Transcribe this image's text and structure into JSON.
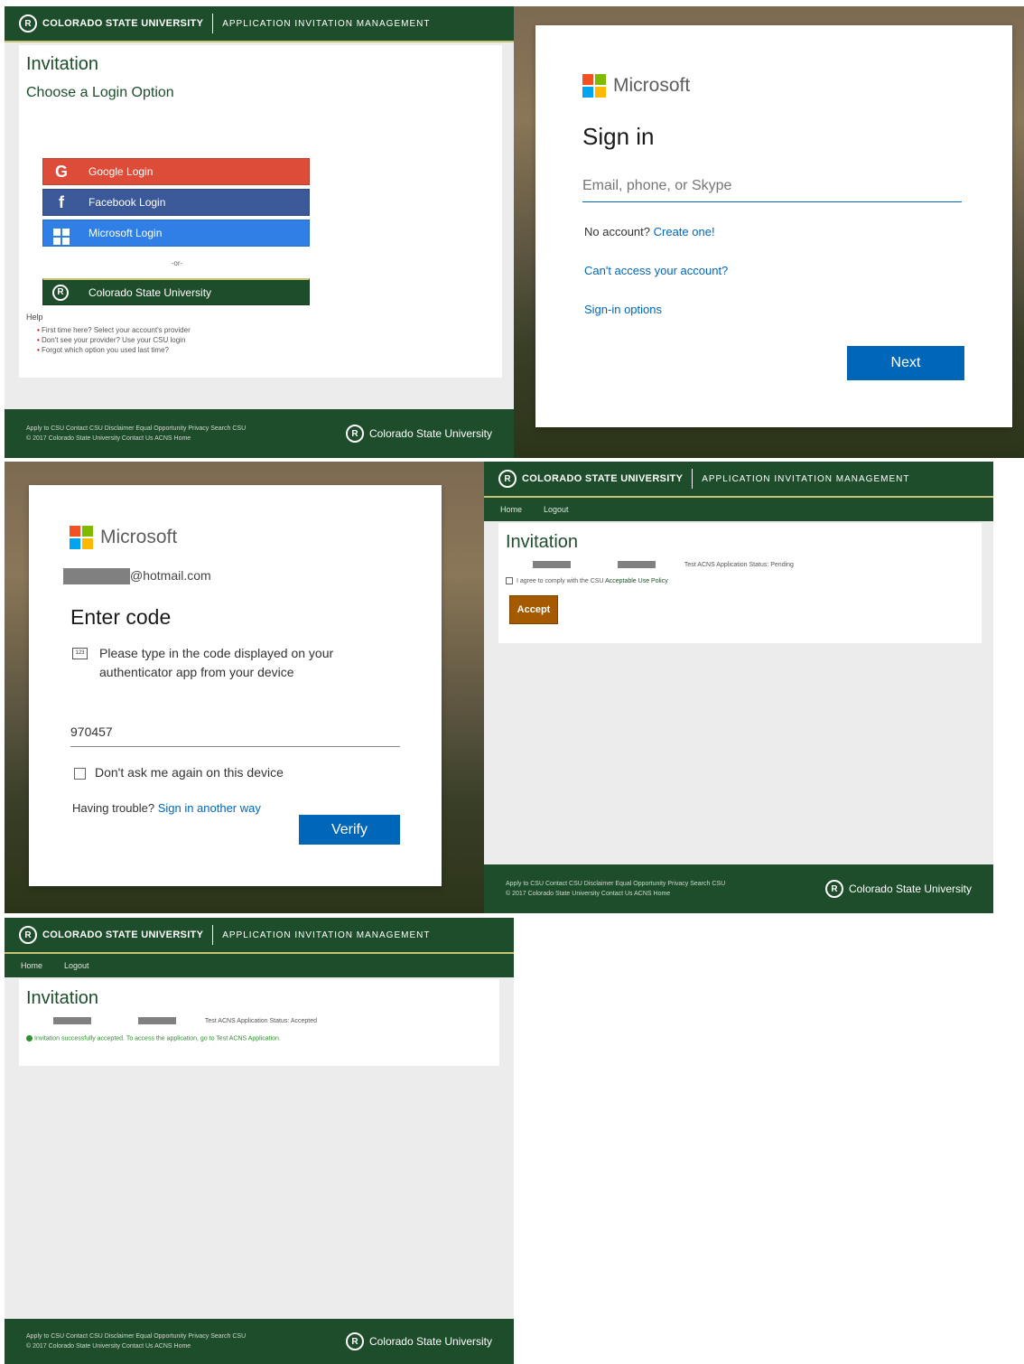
{
  "csu": {
    "university_name": "COLORADO STATE UNIVERSITY",
    "app_name": "APPLICATION INVITATION MANAGEMENT",
    "nav": [
      "Home",
      "Logout"
    ],
    "footer_line1": "Apply to CSU   Contact CSU   Disclaimer   Equal Opportunity   Privacy   Search CSU",
    "footer_line2": "© 2017 Colorado State University   Contact Us   ACNS Home",
    "footer_logo": "Colorado State University"
  },
  "panel1": {
    "title": "Invitation",
    "subtitle": "Choose a Login Option",
    "buttons": [
      {
        "icon": "G",
        "label": "Google Login"
      },
      {
        "icon": "f",
        "label": "Facebook Login"
      },
      {
        "icon": "win",
        "label": "Microsoft Login"
      },
      {
        "icon": "ram",
        "label": "Colorado State University"
      }
    ],
    "or": "-or-",
    "help_title": "Help",
    "help_items": [
      "First time here? Select your account's provider",
      "Don't see your provider? Use your CSU login",
      "Forgot which option you used last time?"
    ]
  },
  "panel2": {
    "brand": "Microsoft",
    "heading": "Sign in",
    "placeholder": "Email, phone, or Skype",
    "no_account": "No account?",
    "create": "Create one!",
    "cant_access": "Can't access your account?",
    "signin_options": "Sign-in options",
    "next": "Next"
  },
  "panel3": {
    "brand": "Microsoft",
    "email_suffix": "@hotmail.com",
    "heading": "Enter code",
    "instruction": "Please type in the code displayed on your authenticator app from your device",
    "code_value": "970457",
    "dont_ask": "Don't ask me again on this device",
    "trouble": "Having trouble?",
    "another_way": "Sign in another way",
    "verify": "Verify"
  },
  "panel4": {
    "title": "Invitation",
    "info_line": "Test ACNS Application Status: Pending",
    "agree_text": "I agree to comply with the CSU",
    "policy_link": "Acceptable Use Policy",
    "accept": "Accept"
  },
  "panel5": {
    "title": "Invitation",
    "info_line": "Test ACNS Application Status: Accepted",
    "success": "Invitation successfully accepted. To access the application, go to Test ACNS Application."
  },
  "colors": {
    "csu_green": "#1e4d2b",
    "csu_gold": "#c8c372",
    "ms_blue": "#0067b8",
    "google_red": "#dd4b39",
    "facebook_blue": "#3b5998",
    "microsoft_blue": "#2f7fe6",
    "accept_orange": "#a55a00"
  }
}
